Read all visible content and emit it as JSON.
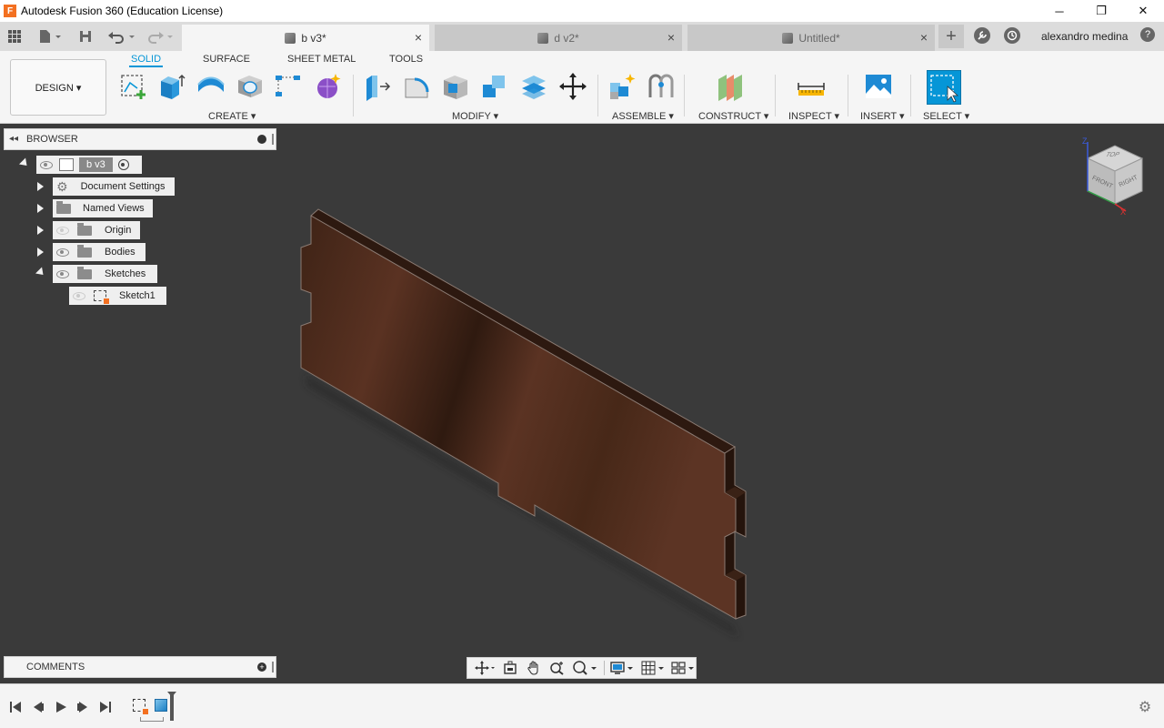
{
  "window": {
    "logo_letter": "F",
    "title": "Autodesk Fusion 360 (Education License)",
    "minimize": "─",
    "restore": "❐",
    "close": "✕"
  },
  "tabs": [
    {
      "label": "b v3*",
      "active": true
    },
    {
      "label": "d v2*",
      "active": false
    },
    {
      "label": "Untitled*",
      "active": false
    }
  ],
  "tab_close": "×",
  "add_tab": "+",
  "user": {
    "name": "alexandro medina"
  },
  "help": "?",
  "ribbon": {
    "workspace": "DESIGN ▾",
    "tabs": [
      "SOLID",
      "SURFACE",
      "SHEET METAL",
      "TOOLS"
    ],
    "groups": [
      "CREATE ▾",
      "MODIFY ▾",
      "ASSEMBLE ▾",
      "CONSTRUCT ▾",
      "INSPECT ▾",
      "INSERT ▾",
      "SELECT ▾"
    ]
  },
  "browser": {
    "title": "BROWSER",
    "root": "b v3",
    "items": [
      "Document Settings",
      "Named Views",
      "Origin",
      "Bodies",
      "Sketches"
    ],
    "sketch": "Sketch1"
  },
  "comments": {
    "title": "COMMENTS"
  },
  "viewcube": {
    "top": "TOP",
    "front": "FRONT",
    "right": "RIGHT",
    "axis_z": "Z",
    "axis_x": "X"
  },
  "colors": {
    "accent": "#0696d7",
    "viewport": "#3a3a3a",
    "wood": "#4a2a1c"
  }
}
